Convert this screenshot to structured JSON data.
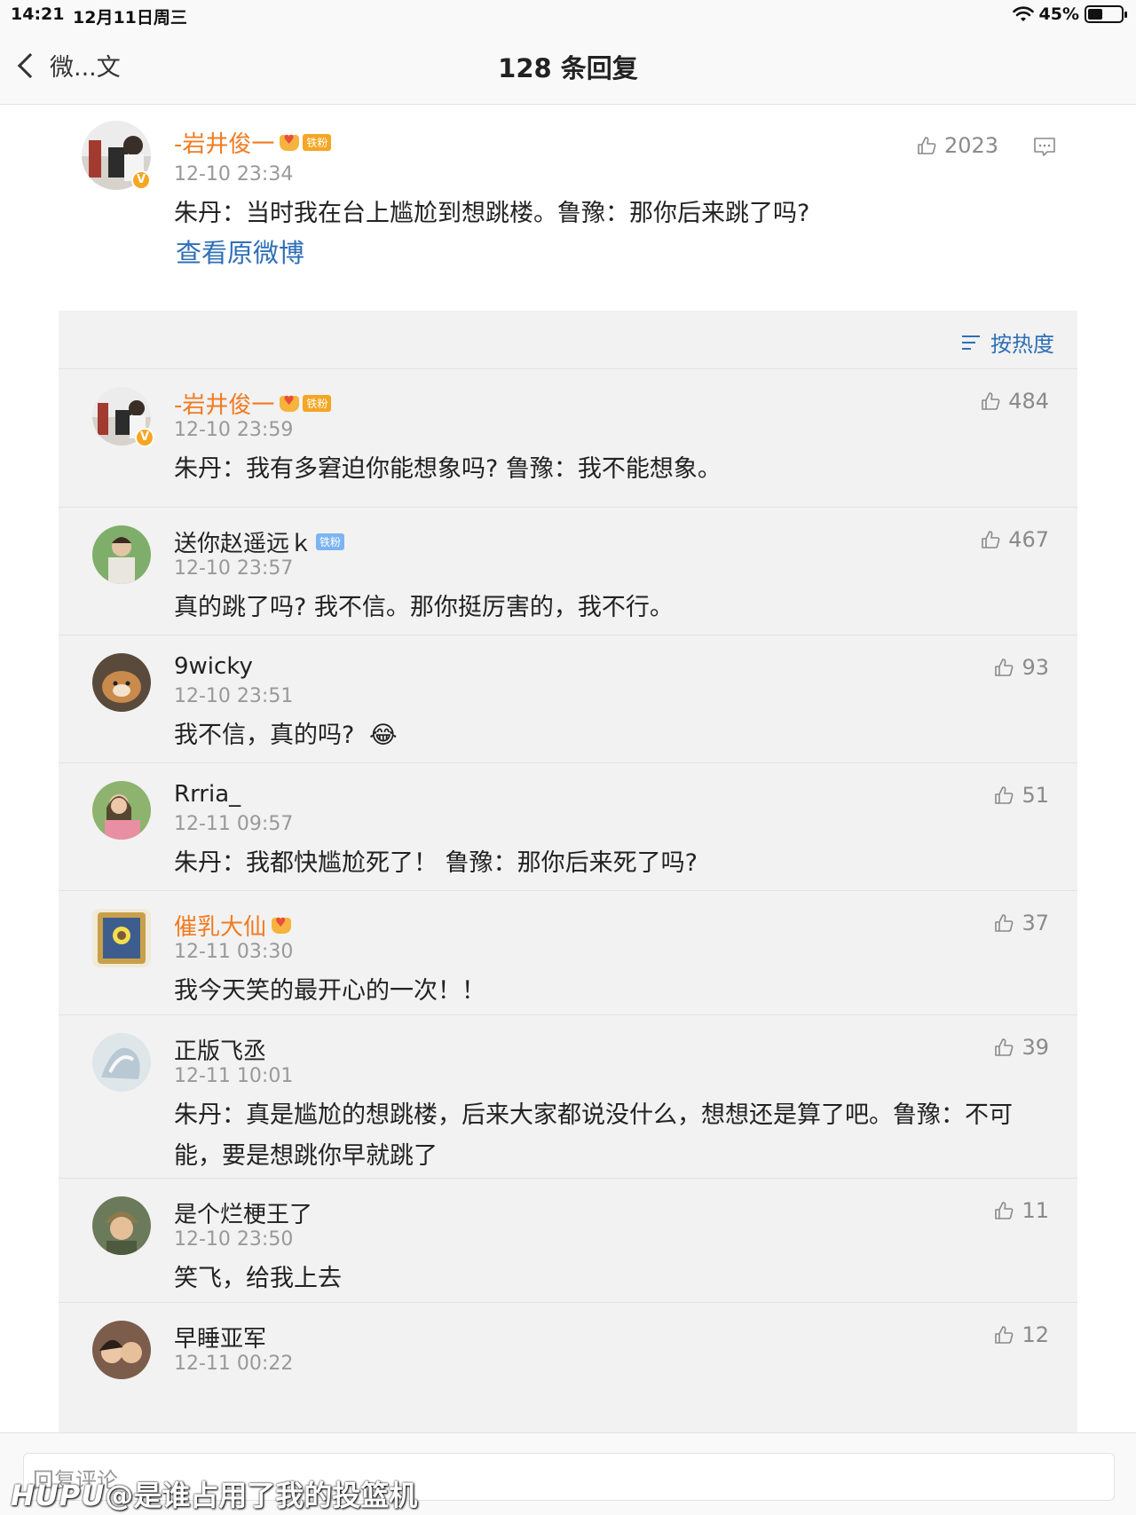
{
  "status_bar": {
    "time": "14:21",
    "date": "12月11日周三",
    "battery": "45%",
    "battery_level": 0.45
  },
  "nav": {
    "back_label": "微...文",
    "title": "128 条回复"
  },
  "post": {
    "author": "-岩井俊一",
    "fan_badge": "铁粉",
    "time": "12-10 23:34",
    "likes": "2023",
    "text": "朱丹：当时我在台上尴尬到想跳楼。鲁豫：那你后来跳了吗?",
    "view_original": "查看原微博"
  },
  "sort_label": "按热度",
  "comments": [
    {
      "author": "-岩井俊一",
      "fan_badge": "铁粉",
      "time": "12-10 23:59",
      "likes": "484",
      "text": "朱丹：我有多窘迫你能想象吗? 鲁豫：我不能想象。"
    },
    {
      "author": "送你赵遥远ｋ",
      "fan_badge": "铁粉",
      "time": "12-10 23:57",
      "likes": "467",
      "text": "真的跳了吗? 我不信。那你挺厉害的，我不行。"
    },
    {
      "author": "9wicky",
      "time": "12-10 23:51",
      "likes": "93",
      "text": "我不信，真的吗?",
      "emoji": "😂"
    },
    {
      "author": "Rrria_",
      "time": "12-11 09:57",
      "likes": "51",
      "text": "朱丹：我都快尴尬死了！ 鲁豫：那你后来死了吗?"
    },
    {
      "author": "催乳大仙",
      "time": "12-11 03:30",
      "likes": "37",
      "text": "我今天笑的最开心的一次！！"
    },
    {
      "author": "正版飞丞",
      "time": "12-11 10:01",
      "likes": "39",
      "text": "朱丹：真是尴尬的想跳楼，后来大家都说没什么，想想还是算了吧。鲁豫：不可能，要是想跳你早就跳了"
    },
    {
      "author": "是个烂梗王了",
      "time": "12-10 23:50",
      "likes": "11",
      "text": "笑飞，给我上去"
    },
    {
      "author": "早睡亚军",
      "time": "12-11 00:22",
      "likes": "12",
      "text": ""
    }
  ],
  "reply_placeholder": "回复评论",
  "watermark": {
    "brand": "HUPU",
    "handle": "@是谁占用了我的投篮机"
  },
  "colors": {
    "link_blue": "#2e6fb7",
    "vip_orange": "#f07b22",
    "background_gray": "#f2f2f2"
  }
}
